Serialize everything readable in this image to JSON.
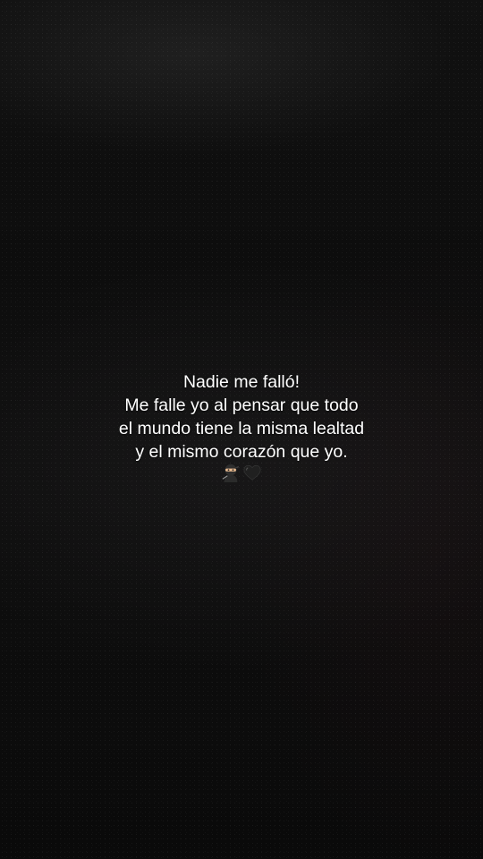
{
  "caption": {
    "lines": [
      "Nadie me falló!",
      "Me falle yo al pensar que todo",
      "el mundo tiene la misma lealtad",
      "y el mismo corazón que yo."
    ],
    "emojis": [
      "ninja-icon",
      "black-heart-icon"
    ]
  },
  "colors": {
    "background": "#0b0b0b",
    "text": "#ffffff"
  }
}
